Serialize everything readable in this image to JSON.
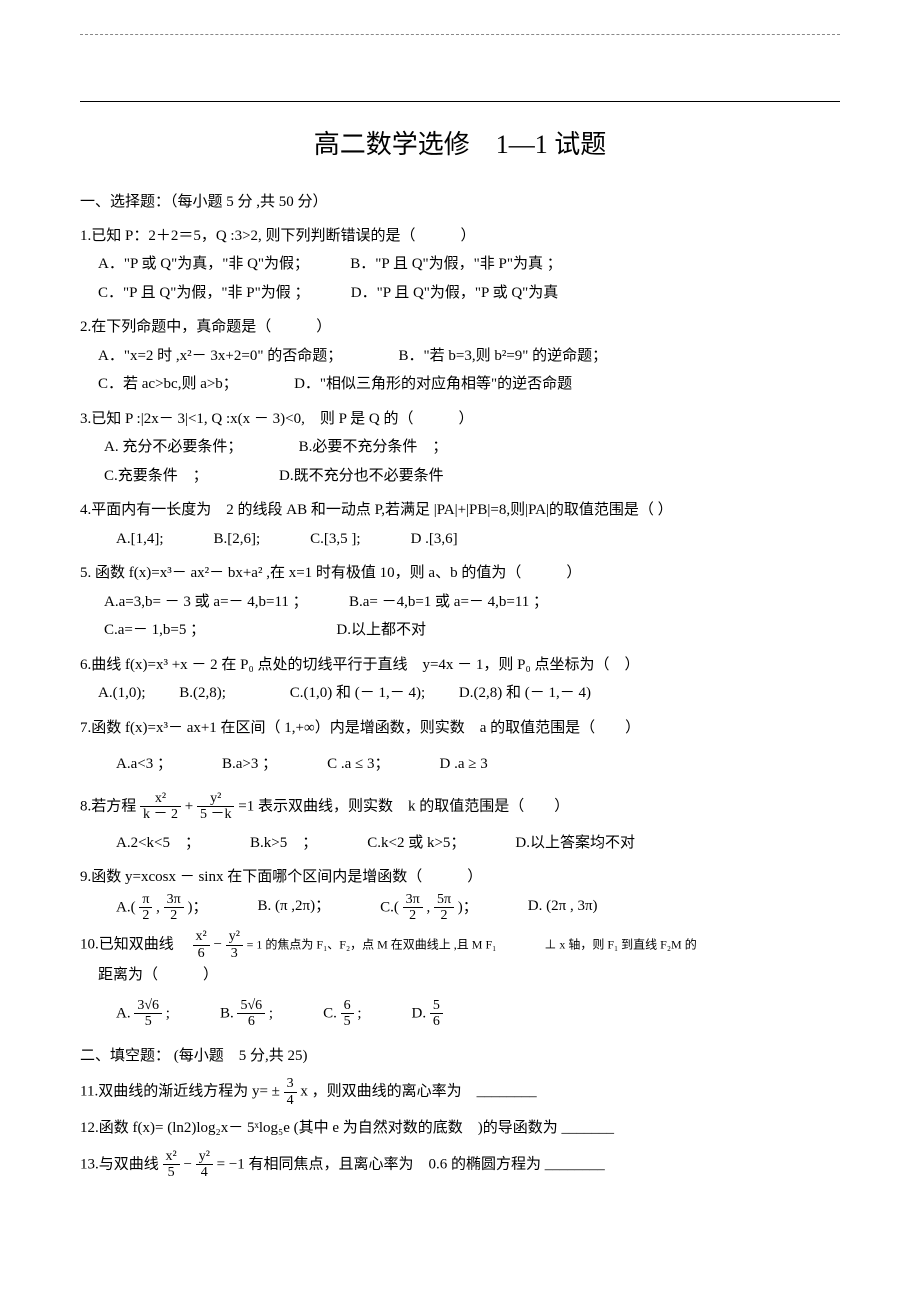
{
  "title": "高二数学选修　1—1 试题",
  "section1": {
    "header": "一、选择题：（每小题 5 分 ,共 50 分）",
    "q1": {
      "stem": "1.已知 P：2＋2＝5，Q :3>2, 则下列判断错误的是（　　　）",
      "a": "A．\"P 或 Q\"为真，\"非 Q\"为假；",
      "b": "B．\"P 且 Q\"为假，\"非 P\"为真 ；",
      "c": "C．\"P 且 Q\"为假，\"非 P\"为假 ；",
      "d": "D．\"P 且 Q\"为假，\"P 或 Q\"为真"
    },
    "q2": {
      "stem": "2.在下列命题中，真命题是（　　　）",
      "a": "A．\"x=2 时 ,x²－ 3x+2=0\" 的否命题；",
      "b": "B．\"若 b=3,则 b²=9\" 的逆命题；",
      "c": "C．若 ac>bc,则 a>b；",
      "d": "D．\"相似三角形的对应角相等\"的逆否命题"
    },
    "q3": {
      "stem": "3.已知 P :|2x－ 3|<1, Q :x(x － 3)<0,　则 P 是 Q 的（　　　）",
      "a": "A. 充分不必要条件；",
      "b": "B.必要不充分条件　；",
      "c": "C.充要条件　；",
      "d": "D.既不充分也不必要条件"
    },
    "q4": {
      "stem": "4.平面内有一长度为　2 的线段 AB 和一动点 P,若满足 |PA|+|PB|=8,则|PA|的取值范围是（ ）",
      "a": "A.[1,4];",
      "b": "B.[2,6];",
      "c": "C.[3,5 ];",
      "d": "D .[3,6]"
    },
    "q5": {
      "stem": "5. 函数 f(x)=x³－ ax²－ bx+a² ,在 x=1 时有极值 10，则 a、b 的值为（　　　）",
      "a": "A.a=3,b= － 3 或 a=－ 4,b=11 ；",
      "b": "B.a= －4,b=1 或 a=－ 4,b=11 ；",
      "c": "C.a=－ 1,b=5 ；",
      "d": "D.以上都不对"
    },
    "q6": {
      "stem": "6.曲线 f(x)=x³ +x － 2 在 P₀ 点处的切线平行于直线　y=4x － 1，则 P₀ 点坐标为（　）",
      "a": "A.(1,0);",
      "b": "B.(2,8);",
      "c": "C.(1,0) 和 (－ 1,－ 4);",
      "d": "D.(2,8) 和 (－ 1,－ 4)"
    },
    "q7": {
      "stem": "7.函数 f(x)=x³－ ax+1 在区间（ 1,+∞）内是增函数，则实数　a 的取值范围是（　　）",
      "a": "A.a<3 ；",
      "b": "B.a>3 ；",
      "c": "C .a ≤ 3；",
      "d": "D .a ≥ 3"
    },
    "q8": {
      "stem_pre": "8.若方程 ",
      "frac1_num": "x²",
      "frac1_den": "k － 2",
      "plus": " + ",
      "frac2_num": "y²",
      "frac2_den": "5 －k",
      "stem_post": " =1 表示双曲线，则实数　k 的取值范围是（　　）",
      "a": "A.2<k<5　；",
      "b": "B.k>5　；",
      "c": "C.k<2 或 k>5；",
      "d": "D.以上答案均不对"
    },
    "q9": {
      "stem": "9.函数 y=xcosx － sinx 在下面哪个区间内是增函数（　　　）",
      "a_pre": "A.( ",
      "a_n1": "π",
      "a_d1": "2",
      "a_mid": " , ",
      "a_n2": "3π",
      "a_d2": "2",
      "a_post": " )；",
      "b": "B. (π ,2π)；",
      "c_pre": "C.( ",
      "c_n1": "3π",
      "c_d1": "2",
      "c_mid": " , ",
      "c_n2": "5π",
      "c_d2": "2",
      "c_post": " )；",
      "d": "D. (2π , 3π)"
    },
    "q10": {
      "stem_pre": "10.已知双曲线　",
      "frac1_num": "x²",
      "frac1_den": "6",
      "minus": " − ",
      "frac2_num": "y²",
      "frac2_den": "3",
      "stem_mid": " = 1 的焦点为 F₁、F₂，点 M 在双曲线上 ,且 M F₁　　　　⊥ x 轴，则 F₁ 到直线 F₂M 的",
      "stem_post": "距离为（　　　）",
      "a_pre": "A. ",
      "a_num": "3√6",
      "a_den": "5",
      "a_post": " ;",
      "b_pre": "B. ",
      "b_num": "5√6",
      "b_den": "6",
      "b_post": " ;",
      "c_pre": "C. ",
      "c_num": "6",
      "c_den": "5",
      "c_post": " ;",
      "d_pre": "D. ",
      "d_num": "5",
      "d_den": "6"
    }
  },
  "section2": {
    "header": "二、填空题： (每小题　5 分,共 25)",
    "q11": {
      "pre": "11.双曲线的渐近线方程为 y= ±",
      "num": "3",
      "den": "4",
      "post": " x ，则双曲线的离心率为　________"
    },
    "q12": "12.函数 f(x)= (ln2)log₂x－ 5ˣlog₅e (其中 e 为自然对数的底数　)的导函数为 _______",
    "q13": {
      "pre": "13.与双曲线 ",
      "n1": "x²",
      "d1": "5",
      "minus": " − ",
      "n2": "y²",
      "d2": "4",
      "post": " = −1 有相同焦点，且离心率为　0.6 的椭圆方程为 ________"
    }
  }
}
